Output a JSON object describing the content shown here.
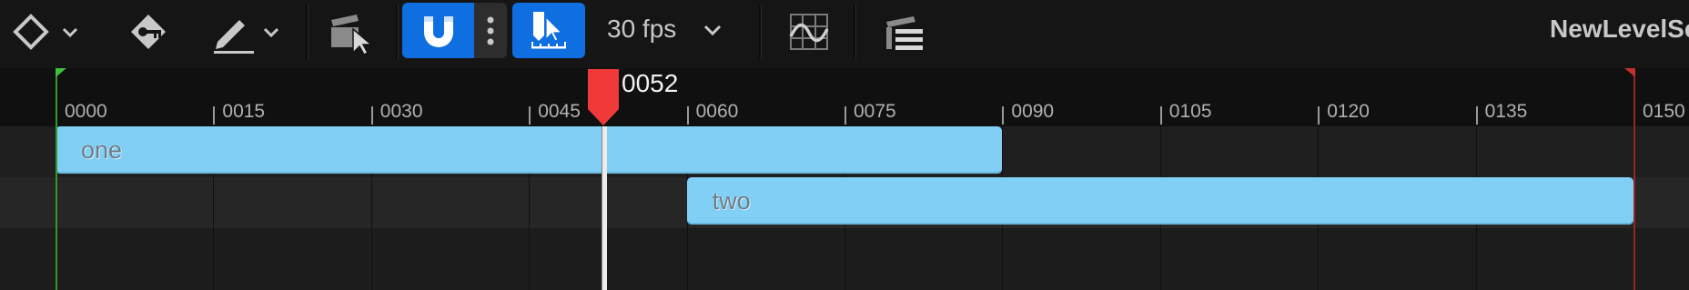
{
  "toolbar": {
    "fps_label": "30 fps",
    "sequence_name": "NewLevelSe",
    "icons": [
      "keyframe-diamond-icon",
      "dropdown-chevron-icon",
      "key-icon",
      "pencil-icon",
      "dropdown-chevron-icon",
      "clapper-select-icon",
      "magnet-icon",
      "more-vertical-icon",
      "playhead-snap-icon",
      "curve-editor-icon",
      "sequencer-list-icon"
    ],
    "snap_enabled": true,
    "select_mode_active": true
  },
  "ruler": {
    "ticks": [
      "0000",
      "0015",
      "0030",
      "0045",
      "0060",
      "0075",
      "0090",
      "0105",
      "0120",
      "0135",
      "0150"
    ]
  },
  "playhead": {
    "frame_label": "0052",
    "frame": 52
  },
  "playback_range": {
    "start": 0,
    "end": 150
  },
  "sections": [
    {
      "label": "one",
      "start": 0,
      "end": 90,
      "row": 0
    },
    {
      "label": "two",
      "start": 60,
      "end": 150,
      "row": 1
    }
  ],
  "colors": {
    "accent": "#0f6fe0",
    "section": "#81cff4",
    "playhead": "#f03a3a",
    "start_marker": "#2e9b2e",
    "end_marker": "#9a2323"
  }
}
